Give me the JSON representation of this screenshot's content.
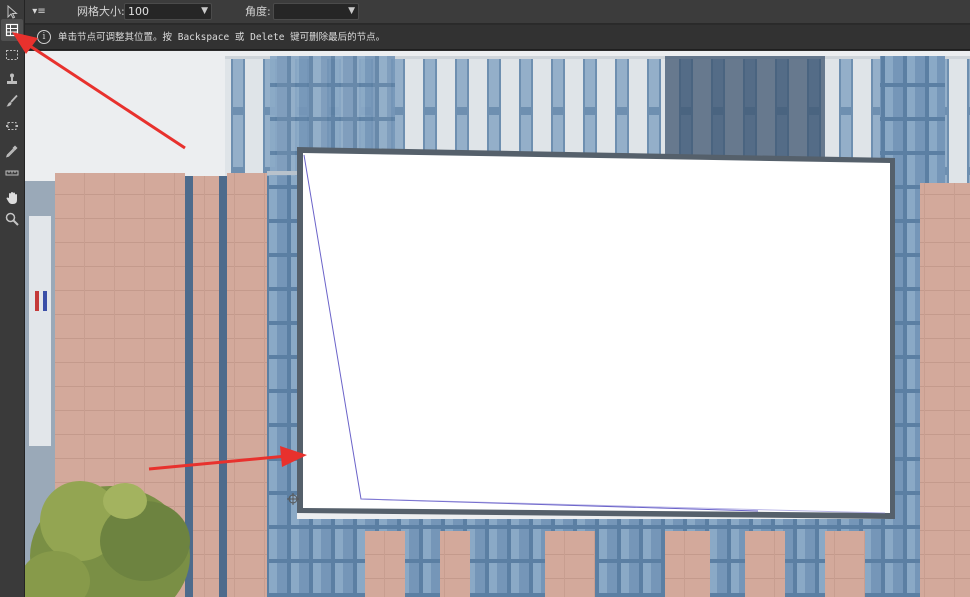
{
  "options_bar": {
    "grid_size_label": "网格大小:",
    "grid_size_value": "100",
    "angle_label": "角度:",
    "angle_value": ""
  },
  "hint": {
    "text": "单击节点可调整其位置。按 Backspace 或 Delete 键可删除最后的节点。"
  },
  "toolbar": {
    "tools": [
      "move-tool-icon",
      "perspective-crop-icon",
      "marquee-icon",
      "stamp-icon",
      "brush-icon",
      "transform-icon",
      "eyedropper-icon",
      "measure-icon",
      "hand-icon",
      "zoom-icon"
    ],
    "active": "perspective-crop-icon"
  },
  "colors": {
    "annotation_arrow": "#e8312d",
    "plane_outline": "#6b63c9",
    "billboard_fill": "#ffffff",
    "building_panel": "#d3a99b"
  }
}
